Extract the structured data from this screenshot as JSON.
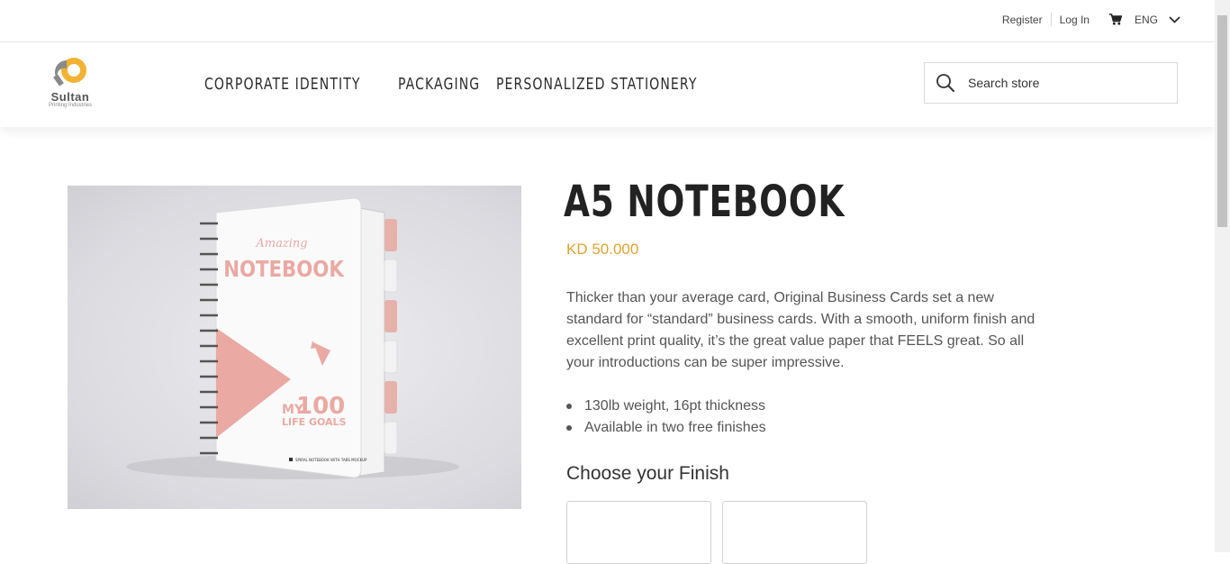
{
  "topbar": {
    "register_label": "Register",
    "login_label": "Log In",
    "cart_icon": "cart-icon",
    "language": "ENG"
  },
  "header": {
    "logo": {
      "name": "Sultan",
      "tagline": "Printing Industries"
    },
    "nav": [
      {
        "label": "CORPORATE IDENTITY"
      },
      {
        "label": "PACKAGING"
      },
      {
        "label": "PERSONALIZED STATIONERY"
      }
    ],
    "search": {
      "placeholder": "Search store"
    }
  },
  "product": {
    "title": "A5 NOTEBOOK",
    "price": "KD 50.000",
    "description": "Thicker than your average card, Original Business Cards set a new standard for “standard” business cards. With a smooth, uniform finish and excellent print quality, it’s the great value paper that FEELS great. So all your introductions can be super impressive.",
    "bullets": [
      "130lb weight, 16pt thickness",
      "Available in two free finishes"
    ],
    "finish_heading": "Choose your Finish",
    "image": {
      "cover_script": "Amazing",
      "cover_title": "NOTEBOOK",
      "cover_my": "MY",
      "cover_number": "100",
      "cover_goals": "LIFE GOALS",
      "cover_footer": "SPIRAL NOTEBOOK WITH TABS MOCKUP"
    }
  },
  "colors": {
    "accent": "#e0a32f",
    "cover_pink": "#eaa9a3",
    "text": "#333333"
  }
}
